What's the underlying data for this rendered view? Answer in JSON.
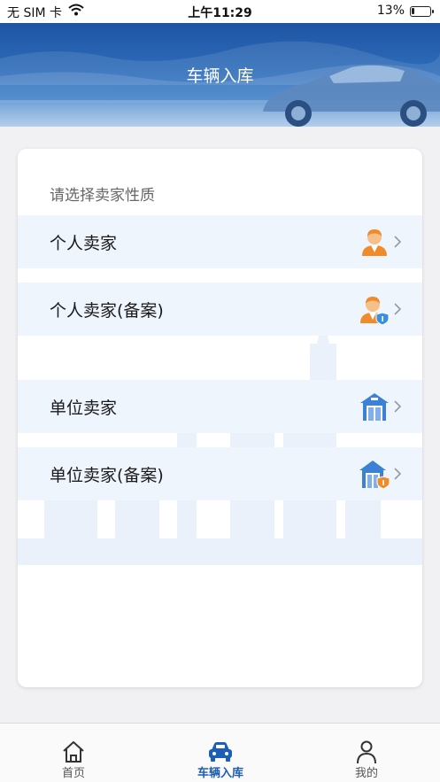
{
  "status_bar": {
    "carrier": "无 SIM 卡",
    "time": "上午11:29",
    "battery": "13%"
  },
  "header": {
    "title": "车辆入库"
  },
  "card": {
    "prompt": "请选择卖家性质",
    "options": [
      {
        "label": "个人卖家",
        "icon": "person-seller-icon"
      },
      {
        "label": "个人卖家(备案)",
        "icon": "person-seller-registered-icon"
      },
      {
        "label": "单位卖家",
        "icon": "company-seller-icon"
      },
      {
        "label": "单位卖家(备案)",
        "icon": "company-seller-registered-icon"
      }
    ]
  },
  "tabbar": {
    "tabs": [
      {
        "label": "首页",
        "icon": "home-icon"
      },
      {
        "label": "车辆入库",
        "icon": "car-icon",
        "active": true
      },
      {
        "label": "我的",
        "icon": "profile-icon"
      }
    ]
  },
  "colors": {
    "brand_blue": "#1d5db5",
    "header_blue": "#2d6bb9",
    "row_bg": "#eef5fd",
    "person_orange": "#f08b2c",
    "building_blue": "#3b82d6"
  }
}
